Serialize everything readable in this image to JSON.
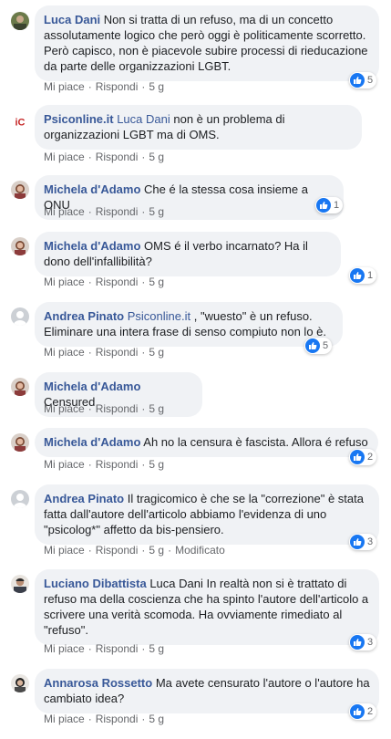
{
  "actions": {
    "like": "Mi piace",
    "reply": "Rispondi",
    "dot": "·",
    "edited": "Modificato"
  },
  "comments": [
    {
      "author": "Luca Dani",
      "mention": "",
      "text": "Non si tratta di un refuso, ma di un concetto assolutamente logico che però oggi è politicamente scorretto. Però capisco, non è piacevole subire processi di rieducazione da parte delle organizzazioni LGBT.",
      "time": "5 g",
      "likes": "5",
      "avatar_icon": "user-photo-icon"
    },
    {
      "author": "Psiconline.it",
      "mention": "Luca Dani",
      "text": "non è un problema di organizzazioni LGBT ma di OMS.",
      "time": "5 g",
      "likes": "",
      "avatar_icon": "page-logo-icon"
    },
    {
      "author": "Michela d'Adamo",
      "mention": "",
      "text": "Che é la stessa cosa insieme a ONU",
      "time": "5 g",
      "likes": "1",
      "avatar_icon": "user-photo-icon"
    },
    {
      "author": "Michela d'Adamo",
      "mention": "",
      "text": "OMS é il verbo incarnato? Ha il dono dell'infallibilità?",
      "time": "5 g",
      "likes": "1",
      "avatar_icon": "user-photo-icon"
    },
    {
      "author": "Andrea Pinato",
      "mention": "Psiconline.it",
      "text": ", \"wuesto\" è un refuso. Eliminare una intera frase di senso compiuto non lo è.",
      "time": "5 g",
      "likes": "5",
      "avatar_icon": "default-avatar-icon"
    },
    {
      "author": "Michela d'Adamo",
      "mention": "",
      "text": "Censured",
      "time": "5 g",
      "likes": "",
      "avatar_icon": "user-photo-icon"
    },
    {
      "author": "Michela d'Adamo",
      "mention": "",
      "text": "Ah no la censura è fascista. Allora é refuso",
      "time": "5 g",
      "likes": "2",
      "avatar_icon": "user-photo-icon"
    },
    {
      "author": "Andrea Pinato",
      "mention": "",
      "text": "Il tragicomico è che se la \"correzione\" è stata fatta dall'autore dell'articolo abbiamo l'evidenza di uno \"psicolog*\" affetto da bis-pensiero.",
      "time": "5 g",
      "likes": "3",
      "edited": true,
      "avatar_icon": "default-avatar-icon"
    },
    {
      "author": "Luciano Dibattista",
      "mention": "",
      "text": "Luca Dani In realtà non si è trattato di refuso ma della coscienza che ha spinto l'autore dell'articolo a scrivere una verità scomoda. Ha ovviamente rimediato al \"refuso\".",
      "time": "5 g",
      "likes": "3",
      "avatar_icon": "user-photo-icon"
    },
    {
      "author": "Annarosa Rossetto",
      "mention": "",
      "text": "Ma avete censurato l'autore o l'autore ha cambiato idea?",
      "time": "5 g",
      "likes": "2",
      "avatar_icon": "user-photo-icon"
    }
  ]
}
